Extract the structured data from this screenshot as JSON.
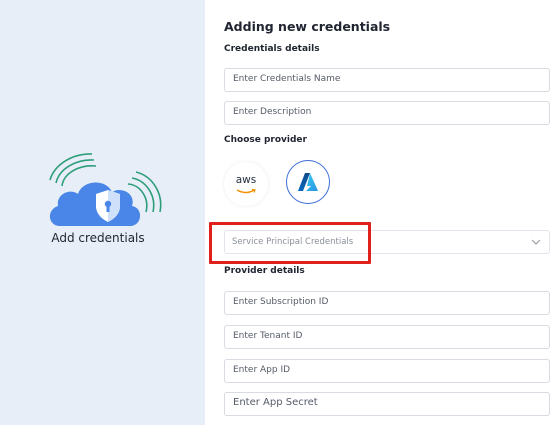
{
  "left": {
    "caption": "Add credentials"
  },
  "form": {
    "title": "Adding new credentials",
    "credentials_section": "Credentials details",
    "name_placeholder": "Enter Credentials Name",
    "description_placeholder": "Enter Description",
    "provider_section": "Choose provider",
    "providers": [
      {
        "name": "aws",
        "label": "aws",
        "selected": false
      },
      {
        "name": "azure",
        "label": "",
        "selected": true
      }
    ],
    "credential_type": "Service Principal Credentials",
    "provider_details_section": "Provider details",
    "subscription_placeholder": "Enter Subscription ID",
    "tenant_placeholder": "Enter Tenant ID",
    "app_id_placeholder": "Enter App ID",
    "app_secret_placeholder": "Enter App Secret"
  },
  "colors": {
    "left_panel": "#e7eef8",
    "cloud": "#4a86e8",
    "waves": "#2e9e7a",
    "azure_accent": "#3b6fd9",
    "highlight": "#e0201c"
  },
  "icons": [
    "cloud-shield-icon",
    "aws-logo-icon",
    "azure-logo-icon",
    "chevron-down-icon"
  ]
}
